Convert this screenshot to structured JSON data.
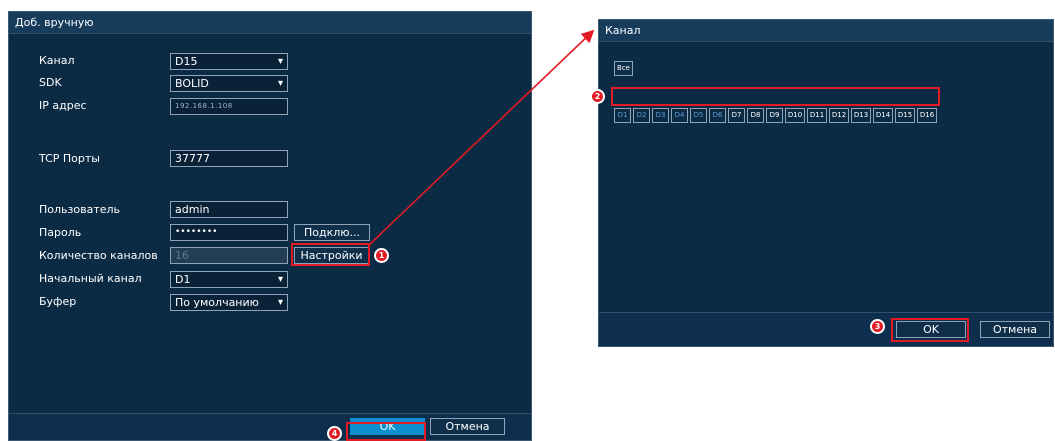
{
  "main_dialog": {
    "title": "Доб. вручную",
    "labels": {
      "channel": "Канал",
      "sdk": "SDK",
      "ip": "IP адрес",
      "tcp": "TCP Порты",
      "user": "Пользователь",
      "password": "Пароль",
      "channel_count": "Количество каналов",
      "start_channel": "Начальный канал",
      "buffer": "Буфер"
    },
    "values": {
      "channel": "D15",
      "sdk": "BOLID",
      "ip": "192.168.1.108",
      "tcp": "37777",
      "user": "admin",
      "password": "••••••••",
      "channel_count": "16",
      "start_channel": "D1",
      "buffer": "По умолчанию"
    },
    "connect_button": "Подклю...",
    "settings_button": "Настройки",
    "ok_button": "OK",
    "cancel_button": "Отмена"
  },
  "channel_dialog": {
    "title": "Канал",
    "all_button": "Все",
    "channels": [
      "D1",
      "D2",
      "D3",
      "D4",
      "D5",
      "D6",
      "D7",
      "D8",
      "D9",
      "D10",
      "D11",
      "D12",
      "D13",
      "D14",
      "D15",
      "D16"
    ],
    "selected_count": 6,
    "ok_button": "OK",
    "cancel_button": "Отмена"
  },
  "markers": {
    "m1": "1",
    "m2": "2",
    "m3": "3",
    "m4": "4"
  },
  "colors": {
    "accent": "#0a8fd1",
    "highlight": "#e21b24",
    "background": "#0b2a44"
  }
}
